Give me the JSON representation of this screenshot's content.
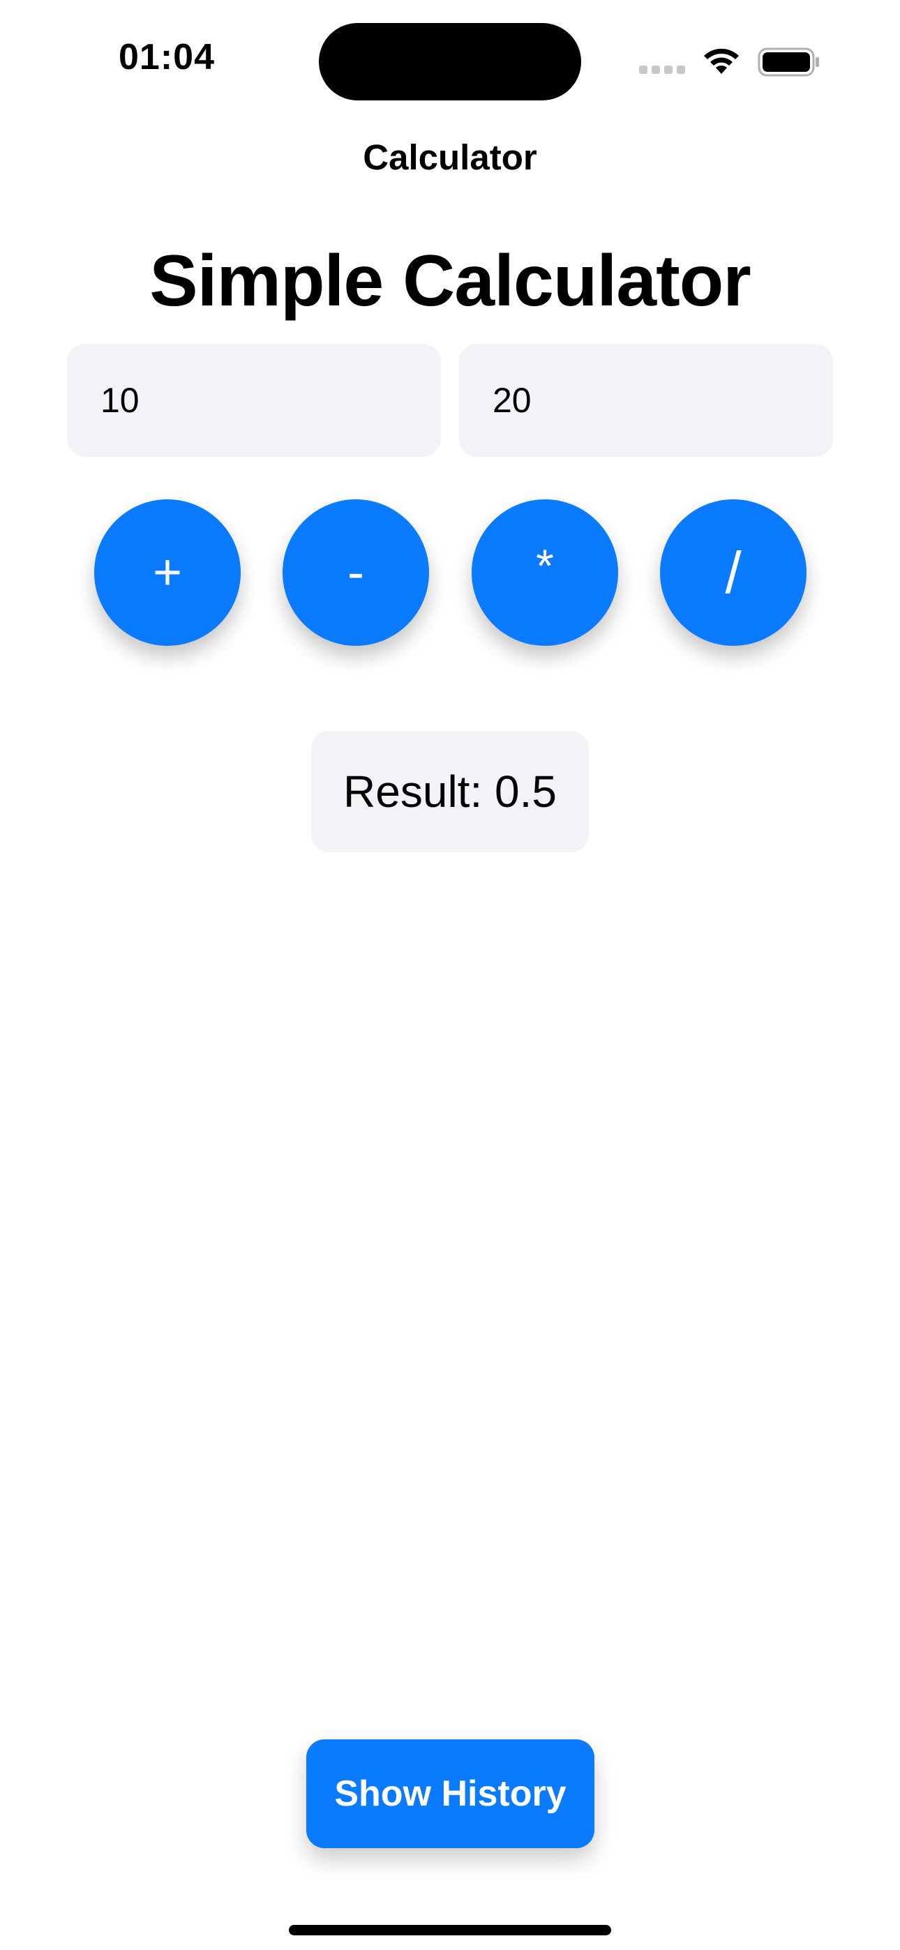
{
  "status_bar": {
    "time": "01:04",
    "icons": [
      "signal-icon",
      "wifi-icon",
      "battery-icon"
    ]
  },
  "nav": {
    "title": "Calculator"
  },
  "main": {
    "title": "Simple Calculator",
    "inputs": [
      {
        "value": "10"
      },
      {
        "value": "20"
      }
    ],
    "operators": [
      "+",
      "-",
      "*",
      "/"
    ],
    "result_text": "Result: 0.5",
    "history_button_label": "Show History"
  },
  "colors": {
    "accent": "#0a7aff",
    "field_background": "#f2f2f7"
  }
}
